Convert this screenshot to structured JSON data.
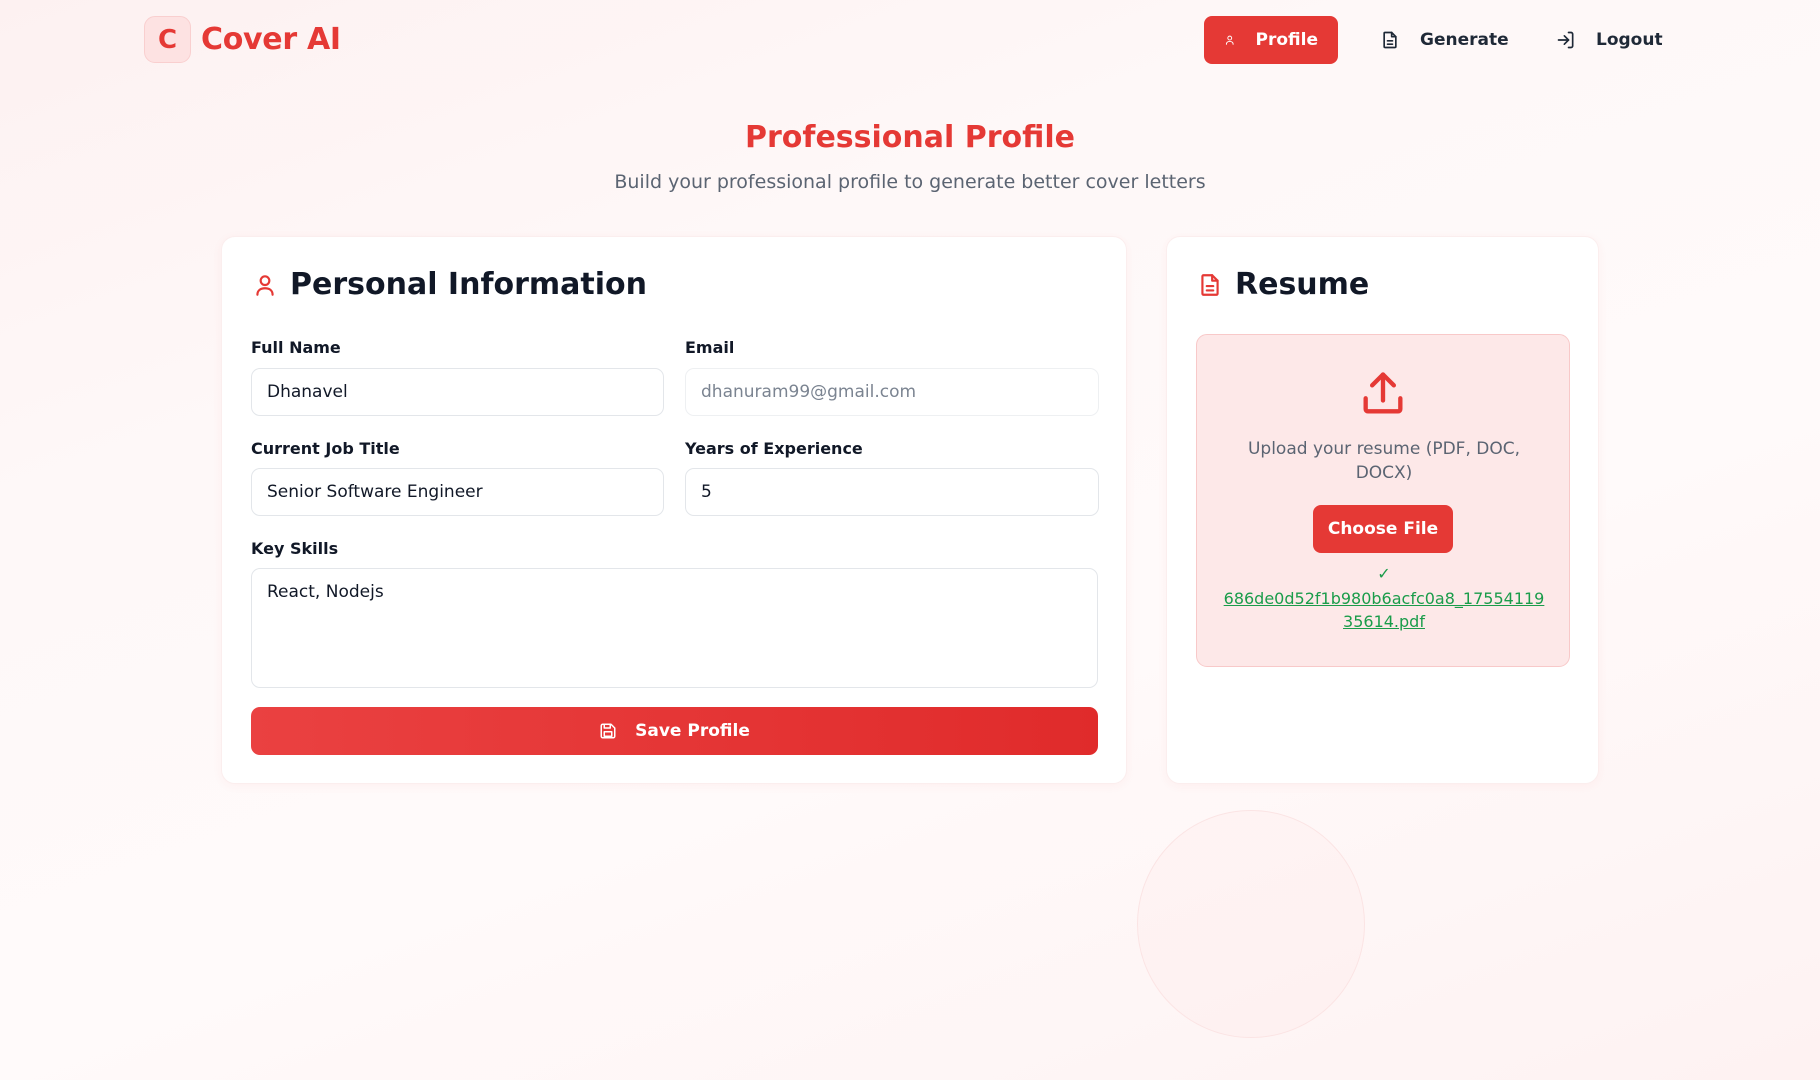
{
  "app": {
    "logo_letter": "C",
    "name": "Cover AI",
    "brand_color": "#e53935"
  },
  "nav": {
    "profile": "Profile",
    "generate": "Generate",
    "logout": "Logout"
  },
  "header": {
    "title": "Professional Profile",
    "subtitle": "Build your professional profile to generate better cover letters"
  },
  "personal": {
    "heading": "Personal Information",
    "full_name_label": "Full Name",
    "full_name_value": "Dhanavel",
    "email_label": "Email",
    "email_value": "dhanuram99@gmail.com",
    "job_title_label": "Current Job Title",
    "job_title_value": "Senior Software Engineer",
    "experience_label": "Years of Experience",
    "experience_value": "5",
    "skills_label": "Key Skills",
    "skills_value": "React, Nodejs",
    "save_label": "Save Profile"
  },
  "resume": {
    "heading": "Resume",
    "upload_text": "Upload your resume (PDF, DOC, DOCX)",
    "choose_label": "Choose File",
    "check": "✓",
    "file_name": "686de0d52f1b980b6acfc0a8_1755411935614.pdf",
    "success_color": "#1a9c4a"
  }
}
